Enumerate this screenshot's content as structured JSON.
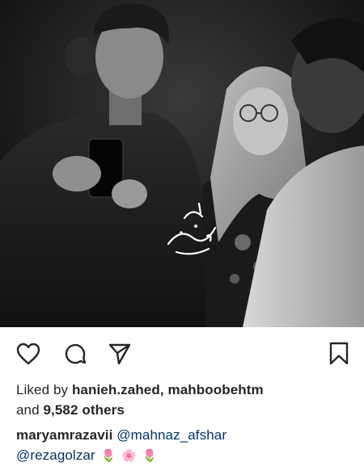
{
  "post": {
    "photo": {
      "watermark_text": "ستاره"
    },
    "actions": {
      "like_icon": "heart-icon",
      "comment_icon": "comment-icon",
      "share_icon": "paper-plane-icon",
      "save_icon": "bookmark-icon"
    },
    "likes": {
      "prefix": "Liked by ",
      "user1": "hanieh.zahed",
      "separator": ", ",
      "user2": "mahboobehtm",
      "line2_prefix": "and ",
      "others_count": "9,582 others"
    },
    "caption": {
      "author": "maryamrazavii",
      "mention1": "@mahnaz_afshar",
      "mention2": "@rezagolzar",
      "emojis": [
        "🌷",
        "🌸",
        "🌷"
      ]
    }
  },
  "colors": {
    "text": "#262626",
    "link": "#003569",
    "background": "#ffffff"
  }
}
